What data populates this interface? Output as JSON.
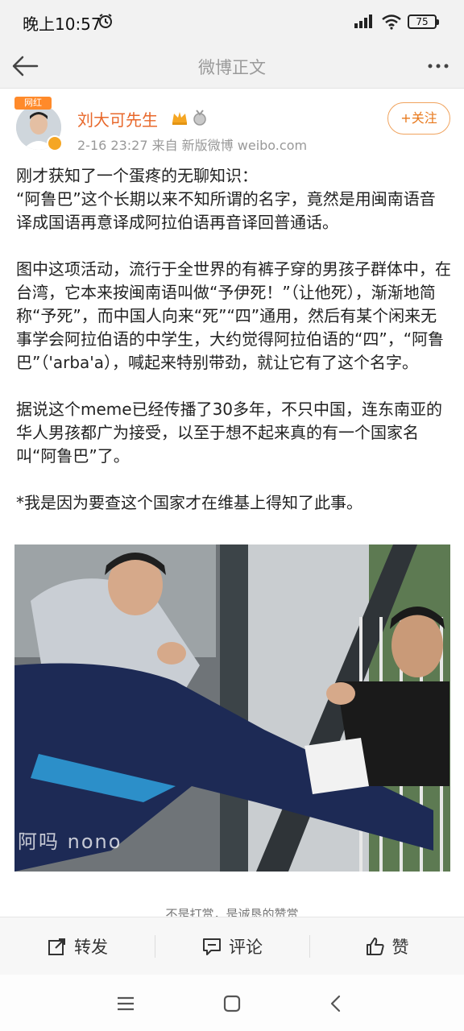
{
  "status": {
    "time": "晚上10:57",
    "battery": "75",
    "icons": [
      "alarm-icon",
      "signal-icon",
      "wifi-icon",
      "battery-icon"
    ]
  },
  "nav": {
    "title": "微博正文",
    "back_icon": "back-arrow-icon",
    "more_icon": "more-dots-icon"
  },
  "post": {
    "avatar_badge": "网红",
    "user_name": "刘大可先生",
    "meta": "2-16 23:27  来自 新版微博 weibo.com",
    "follow_label": "+关注",
    "paragraphs": [
      "刚才获知了一个蛋疼的无聊知识：\n“阿鲁巴”这个长期以来不知所谓的名字，竟然是用闽南语音译成国语再意译成阿拉伯语再音译回普通话。",
      "图中这项活动，流行于全世界的有裤子穿的男孩子群体中，在台湾，它本来按闽南语叫做“予伊死！”（让他死），渐渐地简称“予死”，而中国人向来“死”“四”通用，然后有某个闲来无事学会阿拉伯语的中学生，大约觉得阿拉伯语的“四”，“阿鲁巴”（'arba'a），喊起来特别带劲，就让它有了这个名字。",
      "据说这个meme已经传播了30多年，不只中国，连东南亚的华人男孩都广为接受，以至于想不起来真的有一个国家名叫“阿鲁巴”了。",
      "*我是因为要查这个国家才在维基上得知了此事。"
    ],
    "image_watermark": "阿吗 nono",
    "reward_text": "不是打赏，是诚恳的赞赏"
  },
  "actions": {
    "repost_label": "转发",
    "comment_label": "评论",
    "like_label": "赞"
  },
  "colors": {
    "accent_orange": "#e8682b",
    "follow_orange": "#e8781b",
    "muted_text": "#999999"
  }
}
